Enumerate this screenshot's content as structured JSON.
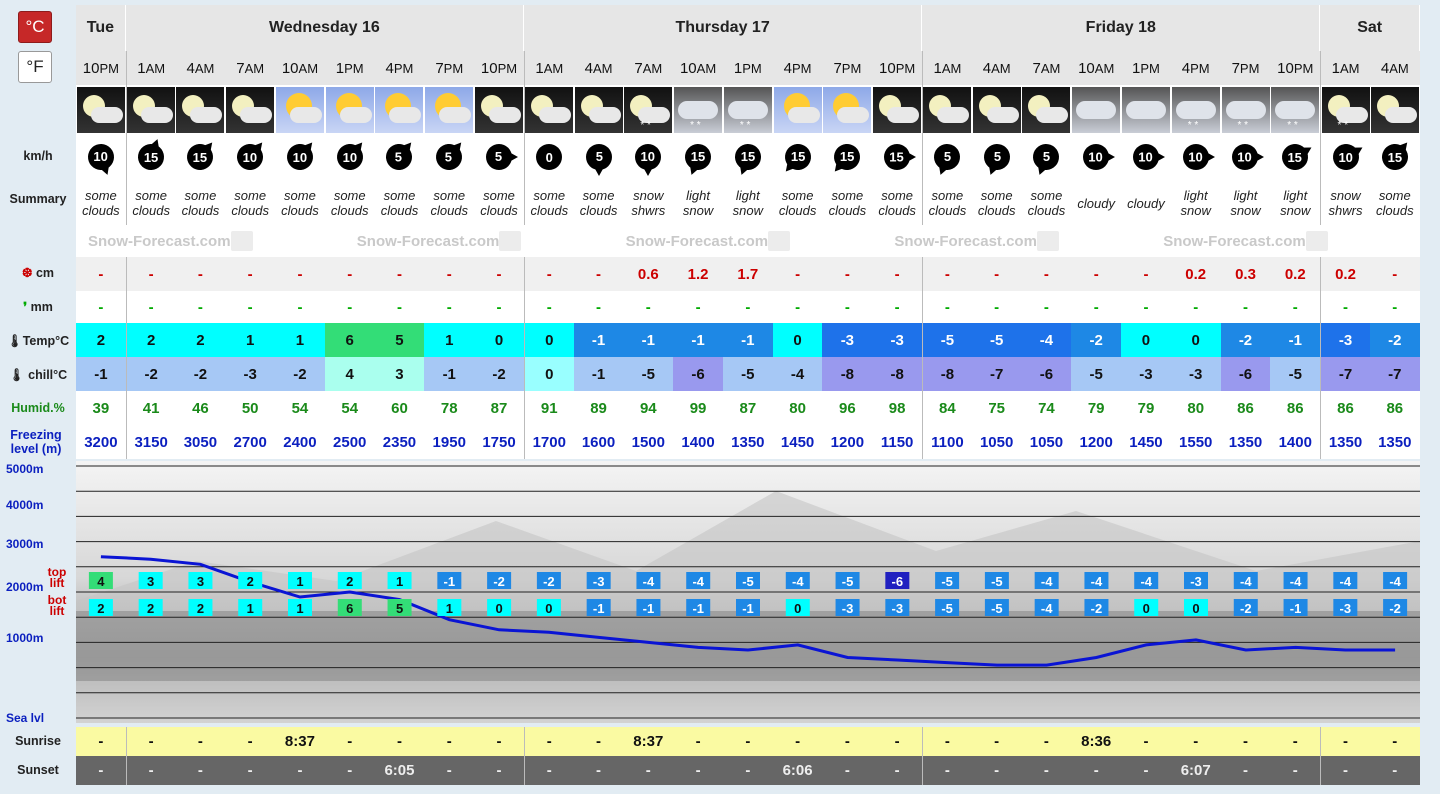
{
  "units": {
    "celsius": "°C",
    "fahrenheit": "°F"
  },
  "labels": {
    "wind": "km/h",
    "summary": "Summary",
    "snow": "cm",
    "rain": "mm",
    "temp": "Temp°C",
    "chill": "chill°C",
    "humid": "Humid.%",
    "freezing": "Freezing level (m)",
    "top_lift": "top lift",
    "bot_lift": "bot lift",
    "sunrise": "Sunrise",
    "sunset": "Sunset",
    "alt_5000": "5000m",
    "alt_4000": "4000m",
    "alt_3000": "3000m",
    "alt_2000": "2000m",
    "alt_1000": "1000m",
    "alt_sea": "Sea lvl"
  },
  "watermark": "Snow-Forecast.com",
  "days": [
    {
      "name": "Tue",
      "span": 1
    },
    {
      "name": "Wednesday 16",
      "span": 8
    },
    {
      "name": "Thursday 17",
      "span": 8
    },
    {
      "name": "Friday 18",
      "span": 8
    },
    {
      "name": "Sat",
      "span": 2
    }
  ],
  "periods": [
    {
      "h": "10",
      "ap": "PM",
      "icon": "moon-cloud-icon",
      "wind": "10",
      "dir": 160,
      "sum": "some clouds",
      "snow": "-",
      "rain": "-",
      "temp": "2",
      "chill": "-1",
      "hum": "39",
      "frz": "3200",
      "rise": "-",
      "set": "-",
      "top": "4",
      "bot": "2"
    },
    {
      "h": "1",
      "ap": "AM",
      "icon": "moon-cloud-icon",
      "wind": "15",
      "dir": 20,
      "sum": "some clouds",
      "snow": "-",
      "rain": "-",
      "temp": "2",
      "chill": "-2",
      "hum": "41",
      "frz": "3150",
      "rise": "-",
      "set": "-",
      "top": "3",
      "bot": "2"
    },
    {
      "h": "4",
      "ap": "AM",
      "icon": "moon-cloud-icon",
      "wind": "15",
      "dir": 40,
      "sum": "some clouds",
      "snow": "-",
      "rain": "-",
      "temp": "2",
      "chill": "-2",
      "hum": "46",
      "frz": "3050",
      "rise": "-",
      "set": "-",
      "top": "3",
      "bot": "2"
    },
    {
      "h": "7",
      "ap": "AM",
      "icon": "moon-cloud-icon",
      "wind": "10",
      "dir": 40,
      "sum": "some clouds",
      "snow": "-",
      "rain": "-",
      "temp": "1",
      "chill": "-3",
      "hum": "50",
      "frz": "2700",
      "rise": "-",
      "set": "-",
      "top": "2",
      "bot": "1"
    },
    {
      "h": "10",
      "ap": "AM",
      "icon": "sun-cloud-icon",
      "wind": "10",
      "dir": 40,
      "sum": "some clouds",
      "snow": "-",
      "rain": "-",
      "temp": "1",
      "chill": "-2",
      "hum": "54",
      "frz": "2400",
      "rise": "8:37",
      "set": "-",
      "top": "1",
      "bot": "1"
    },
    {
      "h": "1",
      "ap": "PM",
      "icon": "sun-cloud-icon",
      "wind": "10",
      "dir": 40,
      "sum": "some clouds",
      "snow": "-",
      "rain": "-",
      "temp": "6",
      "chill": "4",
      "hum": "54",
      "frz": "2500",
      "rise": "-",
      "set": "-",
      "top": "2",
      "bot": "6"
    },
    {
      "h": "4",
      "ap": "PM",
      "icon": "sun-cloud-icon",
      "wind": "5",
      "dir": 40,
      "sum": "some clouds",
      "snow": "-",
      "rain": "-",
      "temp": "5",
      "chill": "3",
      "hum": "60",
      "frz": "2350",
      "rise": "-",
      "set": "6:05",
      "top": "1",
      "bot": "5"
    },
    {
      "h": "7",
      "ap": "PM",
      "icon": "sun-cloud-icon",
      "wind": "5",
      "dir": 40,
      "sum": "some clouds",
      "snow": "-",
      "rain": "-",
      "temp": "1",
      "chill": "-1",
      "hum": "78",
      "frz": "1950",
      "rise": "-",
      "set": "-",
      "top": "-1",
      "bot": "1"
    },
    {
      "h": "10",
      "ap": "PM",
      "icon": "moon-cloud-icon",
      "wind": "5",
      "dir": 90,
      "sum": "some clouds",
      "snow": "-",
      "rain": "-",
      "temp": "0",
      "chill": "-2",
      "hum": "87",
      "frz": "1750",
      "rise": "-",
      "set": "-",
      "top": "-2",
      "bot": "0"
    },
    {
      "h": "1",
      "ap": "AM",
      "icon": "moon-cloud-icon",
      "wind": "0",
      "dir": 0,
      "sum": "some clouds",
      "snow": "-",
      "rain": "-",
      "temp": "0",
      "chill": "0",
      "hum": "91",
      "frz": "1700",
      "rise": "-",
      "set": "-",
      "top": "-2",
      "bot": "0"
    },
    {
      "h": "4",
      "ap": "AM",
      "icon": "moon-cloud-icon",
      "wind": "5",
      "dir": 180,
      "sum": "some clouds",
      "snow": "-",
      "rain": "-",
      "temp": "-1",
      "chill": "-1",
      "hum": "89",
      "frz": "1600",
      "rise": "-",
      "set": "-",
      "top": "-3",
      "bot": "-1"
    },
    {
      "h": "7",
      "ap": "AM",
      "icon": "moon-snow-icon",
      "wind": "10",
      "dir": 180,
      "sum": "snow shwrs",
      "snow": "0.6",
      "rain": "-",
      "temp": "-1",
      "chill": "-5",
      "hum": "94",
      "frz": "1500",
      "rise": "8:37",
      "set": "-",
      "top": "-4",
      "bot": "-1"
    },
    {
      "h": "10",
      "ap": "AM",
      "icon": "snow-cloud-icon",
      "wind": "15",
      "dir": 200,
      "sum": "light snow",
      "snow": "1.2",
      "rain": "-",
      "temp": "-1",
      "chill": "-6",
      "hum": "99",
      "frz": "1400",
      "rise": "-",
      "set": "-",
      "top": "-4",
      "bot": "-1"
    },
    {
      "h": "1",
      "ap": "PM",
      "icon": "snow-cloud-icon",
      "wind": "15",
      "dir": 200,
      "sum": "light snow",
      "snow": "1.7",
      "rain": "-",
      "temp": "-1",
      "chill": "-5",
      "hum": "87",
      "frz": "1350",
      "rise": "-",
      "set": "-",
      "top": "-5",
      "bot": "-1"
    },
    {
      "h": "4",
      "ap": "PM",
      "icon": "sun-cloud-icon",
      "wind": "15",
      "dir": 220,
      "sum": "some clouds",
      "snow": "-",
      "rain": "-",
      "temp": "0",
      "chill": "-4",
      "hum": "80",
      "frz": "1450",
      "rise": "-",
      "set": "6:06",
      "top": "-4",
      "bot": "0"
    },
    {
      "h": "7",
      "ap": "PM",
      "icon": "sun-cloud-icon",
      "wind": "15",
      "dir": 220,
      "sum": "some clouds",
      "snow": "-",
      "rain": "-",
      "temp": "-3",
      "chill": "-8",
      "hum": "96",
      "frz": "1200",
      "rise": "-",
      "set": "-",
      "top": "-5",
      "bot": "-3"
    },
    {
      "h": "10",
      "ap": "PM",
      "icon": "moon-cloud-icon",
      "wind": "15",
      "dir": 90,
      "sum": "some clouds",
      "snow": "-",
      "rain": "-",
      "temp": "-3",
      "chill": "-8",
      "hum": "98",
      "frz": "1150",
      "rise": "-",
      "set": "-",
      "top": "-6",
      "bot": "-3"
    },
    {
      "h": "1",
      "ap": "AM",
      "icon": "moon-cloud-icon",
      "wind": "5",
      "dir": 200,
      "sum": "some clouds",
      "snow": "-",
      "rain": "-",
      "temp": "-5",
      "chill": "-8",
      "hum": "84",
      "frz": "1100",
      "rise": "-",
      "set": "-",
      "top": "-5",
      "bot": "-5"
    },
    {
      "h": "4",
      "ap": "AM",
      "icon": "moon-cloud-icon",
      "wind": "5",
      "dir": 200,
      "sum": "some clouds",
      "snow": "-",
      "rain": "-",
      "temp": "-5",
      "chill": "-7",
      "hum": "75",
      "frz": "1050",
      "rise": "-",
      "set": "-",
      "top": "-5",
      "bot": "-5"
    },
    {
      "h": "7",
      "ap": "AM",
      "icon": "moon-cloud-icon",
      "wind": "5",
      "dir": 200,
      "sum": "some clouds",
      "snow": "-",
      "rain": "-",
      "temp": "-4",
      "chill": "-6",
      "hum": "74",
      "frz": "1050",
      "rise": "-",
      "set": "-",
      "top": "-4",
      "bot": "-4"
    },
    {
      "h": "10",
      "ap": "AM",
      "icon": "cloud-icon",
      "wind": "10",
      "dir": 90,
      "sum": "cloudy",
      "snow": "-",
      "rain": "-",
      "temp": "-2",
      "chill": "-5",
      "hum": "79",
      "frz": "1200",
      "rise": "8:36",
      "set": "-",
      "top": "-4",
      "bot": "-2"
    },
    {
      "h": "1",
      "ap": "PM",
      "icon": "cloud-icon",
      "wind": "10",
      "dir": 90,
      "sum": "cloudy",
      "snow": "-",
      "rain": "-",
      "temp": "0",
      "chill": "-3",
      "hum": "79",
      "frz": "1450",
      "rise": "-",
      "set": "-",
      "top": "-4",
      "bot": "0"
    },
    {
      "h": "4",
      "ap": "PM",
      "icon": "snow-cloud-icon",
      "wind": "10",
      "dir": 90,
      "sum": "light snow",
      "snow": "0.2",
      "rain": "-",
      "temp": "0",
      "chill": "-3",
      "hum": "80",
      "frz": "1550",
      "rise": "-",
      "set": "6:07",
      "top": "-3",
      "bot": "0"
    },
    {
      "h": "7",
      "ap": "PM",
      "icon": "snow-cloud-icon",
      "wind": "10",
      "dir": 90,
      "sum": "light snow",
      "snow": "0.3",
      "rain": "-",
      "temp": "-2",
      "chill": "-6",
      "hum": "86",
      "frz": "1350",
      "rise": "-",
      "set": "-",
      "top": "-4",
      "bot": "-2"
    },
    {
      "h": "10",
      "ap": "PM",
      "icon": "snow-cloud-icon",
      "wind": "15",
      "dir": 60,
      "sum": "light snow",
      "snow": "0.2",
      "rain": "-",
      "temp": "-1",
      "chill": "-5",
      "hum": "86",
      "frz": "1400",
      "rise": "-",
      "set": "-",
      "top": "-4",
      "bot": "-1"
    },
    {
      "h": "1",
      "ap": "AM",
      "icon": "moon-snow-icon",
      "wind": "10",
      "dir": 60,
      "sum": "snow shwrs",
      "snow": "0.2",
      "rain": "-",
      "temp": "-3",
      "chill": "-7",
      "hum": "86",
      "frz": "1350",
      "rise": "-",
      "set": "-",
      "top": "-4",
      "bot": "-3"
    },
    {
      "h": "4",
      "ap": "AM",
      "icon": "moon-cloud-icon",
      "wind": "15",
      "dir": 40,
      "sum": "some clouds",
      "snow": "-",
      "rain": "-",
      "temp": "-2",
      "chill": "-7",
      "hum": "86",
      "frz": "1350",
      "rise": "-",
      "set": "-",
      "top": "-4",
      "bot": "-2"
    }
  ],
  "colors": {
    "line": "#0a14d4",
    "snow_text": "#cc0000",
    "rain_text": "#00aa00",
    "humid_text": "#1a8a1a",
    "freezing_text": "#0b1fbf",
    "sunrise_bg": "#fafaa2",
    "sunset_bg": "#666666"
  }
}
